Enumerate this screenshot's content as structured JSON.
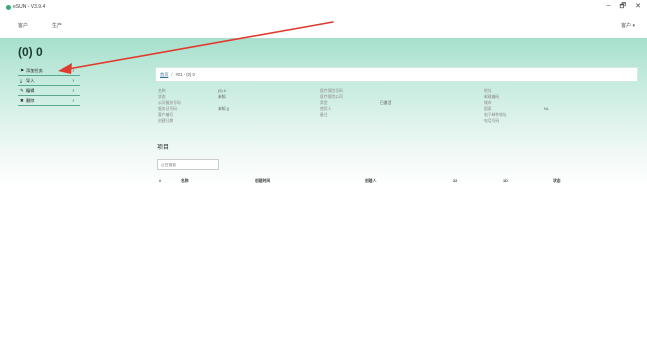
{
  "app": {
    "title": "eSUN - V3.9.4",
    "logo_color": "#3aa876"
  },
  "window_controls": [
    "–",
    "🗗",
    "✕"
  ],
  "menu": {
    "items": [
      "客户",
      "生产"
    ],
    "account": "客户 ▾"
  },
  "page": {
    "title": "(0) 0"
  },
  "sidebar": {
    "items": [
      {
        "icon": "flag-icon",
        "glyph": "⚑",
        "label": "添加任务",
        "chevron": "›"
      },
      {
        "icon": "download-icon",
        "glyph": "⤓",
        "label": "导入",
        "chevron": "›"
      },
      {
        "icon": "pencil-icon",
        "glyph": "✎",
        "label": "编辑",
        "chevron": "›"
      },
      {
        "icon": "trash-icon",
        "glyph": "✖",
        "label": "删除",
        "chevron": "›"
      }
    ]
  },
  "breadcrumb": {
    "home": "首页",
    "sep": "/",
    "current": "#21 - (0) 0"
  },
  "details": {
    "col1": {
      "labels": [
        "名称",
        "状态",
        "公司服务号码",
        "服务证号码",
        "客户编号",
        "创建日期"
      ],
      "values": [
        "(0) 0",
        "未知",
        "",
        "未知 ()",
        "",
        ""
      ]
    },
    "col2": {
      "labels": [
        "医疗保险号码",
        "医疗保险公司",
        "类型",
        "使用人",
        "备注"
      ],
      "values": [
        "",
        "",
        "已激活",
        "",
        ""
      ]
    },
    "col3": {
      "labels": [
        "地址",
        "邮政编码",
        "城市",
        "国家",
        "电子邮件地址",
        "电话号码"
      ],
      "values": [
        "",
        "",
        "",
        "NL",
        "",
        ""
      ]
    }
  },
  "projects": {
    "title": "项目",
    "search_placeholder": "正在搜索",
    "columns": [
      "#",
      "名称",
      "创建时间",
      "创建人",
      "22",
      "1D",
      "状态"
    ]
  },
  "annotation": {
    "color": "#e03b2e"
  }
}
